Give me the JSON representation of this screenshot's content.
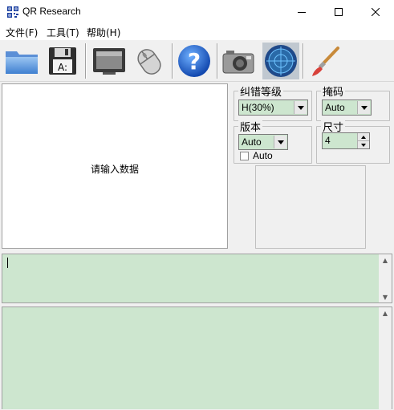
{
  "window": {
    "title": "QR Research",
    "icon": "qr-app-icon",
    "controls": [
      "minimize-icon",
      "maximize-icon",
      "close-icon"
    ]
  },
  "menu": {
    "items": [
      {
        "label": "文件(F)"
      },
      {
        "label": "工具(T)"
      },
      {
        "label": "帮助(H)"
      }
    ]
  },
  "toolbar": {
    "buttons": [
      {
        "icon": "folder-icon"
      },
      {
        "icon": "floppy-save-icon"
      },
      {
        "icon": "monitor-icon"
      },
      {
        "icon": "mouse-icon"
      },
      {
        "icon": "help-icon"
      },
      {
        "icon": "camera-icon"
      },
      {
        "icon": "radar-icon"
      },
      {
        "icon": "brush-icon"
      }
    ]
  },
  "input_area": {
    "prompt": "请输入数据"
  },
  "settings": {
    "error_level": {
      "label": "纠错等级",
      "value": "H(30%)"
    },
    "mask": {
      "label": "掩码",
      "value": "Auto"
    },
    "version": {
      "label": "版本",
      "value": "Auto",
      "checkbox_label": "Auto",
      "checked": false
    },
    "size": {
      "label": "尺寸",
      "value": "4"
    }
  },
  "colors": {
    "field_green": "#cde6cf",
    "window_bg": "#f0f0f0"
  }
}
